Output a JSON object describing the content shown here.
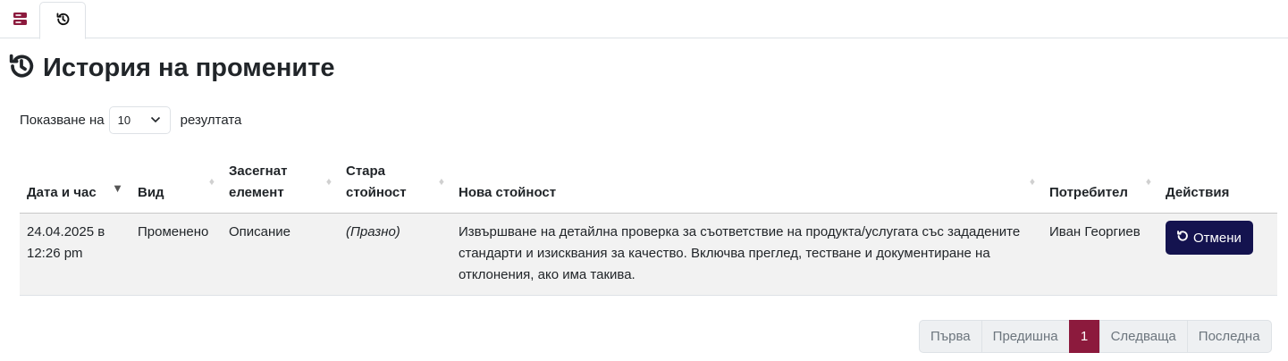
{
  "tabs": [
    {
      "icon": "database-icon",
      "active": false
    },
    {
      "icon": "history-icon",
      "active": true
    }
  ],
  "page": {
    "title": "История на промените",
    "icon": "history-icon"
  },
  "length_control": {
    "prefix": "Показване на",
    "selected": "10",
    "options": [
      "10"
    ],
    "suffix": "резултата"
  },
  "table": {
    "columns": [
      {
        "label": "Дата и час",
        "sort": "desc"
      },
      {
        "label": "Вид",
        "sort": "none"
      },
      {
        "label": "Засегнат елемент",
        "sort": "none"
      },
      {
        "label": "Стара стойност",
        "sort": "none"
      },
      {
        "label": "Нова стойност",
        "sort": "none"
      },
      {
        "label": "Потребител",
        "sort": "none"
      },
      {
        "label": "Действия",
        "sort": null
      }
    ],
    "rows": [
      {
        "datetime": "24.04.2025 в 12:26 pm",
        "type": "Променено",
        "element": "Описание",
        "old_value": "(Празно)",
        "new_value": "Извършване на детайлна проверка за съответствие на продукта/услугата със зададените стандарти и изисквания за качество. Включва преглед, тестване и документиране на отклонения, ако има такива.",
        "user": "Иван Георгиев",
        "action_label": "Отмени"
      }
    ]
  },
  "pagination": {
    "first": "Първа",
    "previous": "Предишна",
    "current": "1",
    "next": "Следваща",
    "last": "Последна"
  },
  "colors": {
    "primary_dark": "#14134f",
    "accent": "#8c1a3d"
  }
}
